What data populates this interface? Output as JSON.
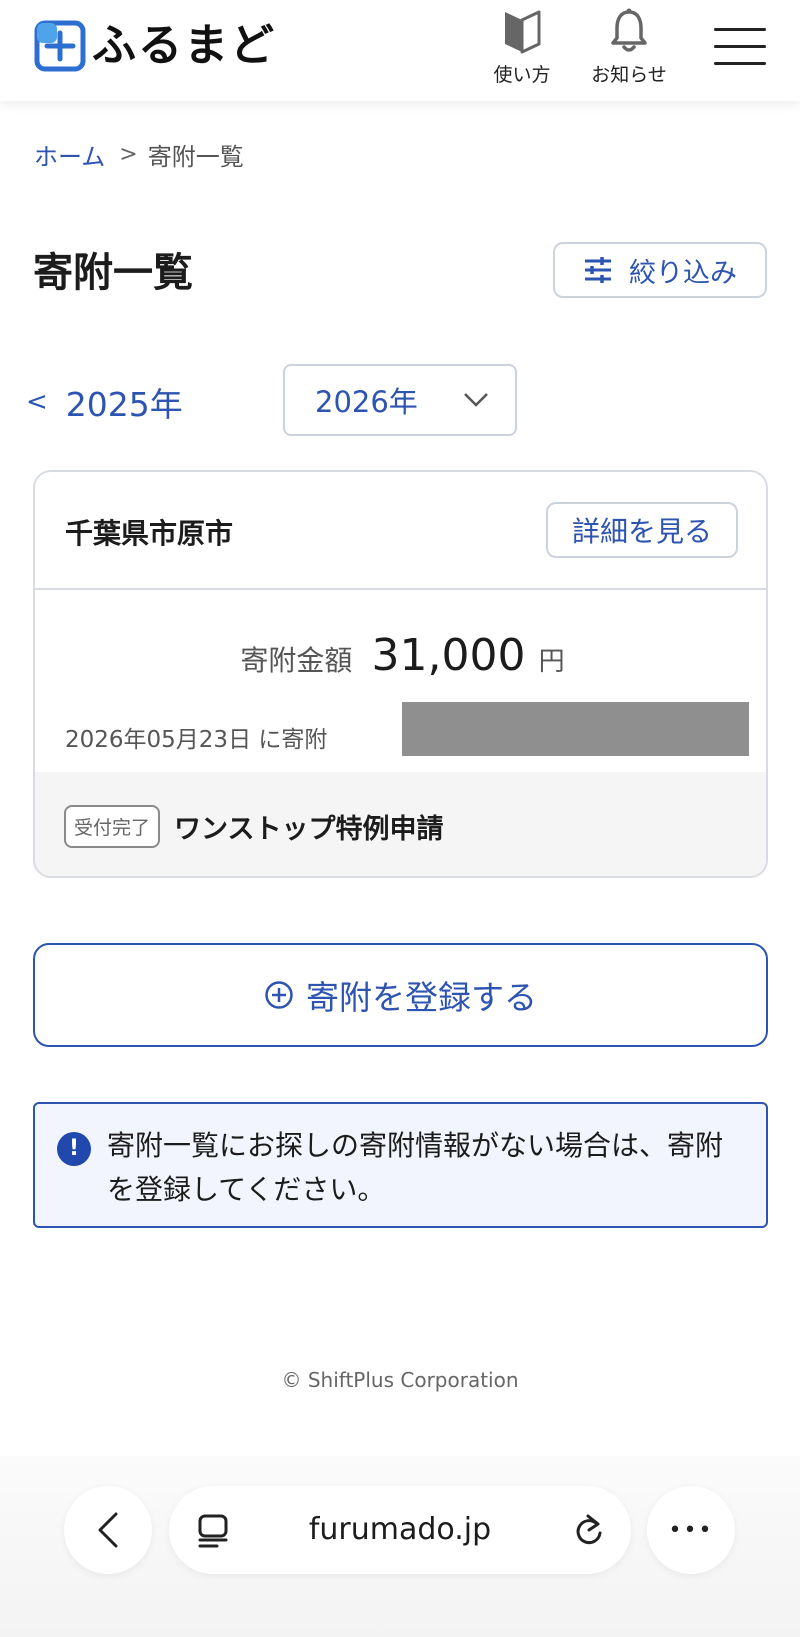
{
  "header": {
    "logo_text": "ふるまど",
    "howto_label": "使い方",
    "notice_label": "お知らせ"
  },
  "breadcrumb": {
    "home": "ホーム",
    "separator": ">",
    "current": "寄附一覧"
  },
  "page": {
    "title": "寄附一覧",
    "filter_label": "絞り込み"
  },
  "year_nav": {
    "prev_chevron": "<",
    "prev_year": "2025年",
    "selected_year": "2026年"
  },
  "donations": [
    {
      "municipality": "千葉県市原市",
      "detail_label": "詳細を見る",
      "amount_label": "寄附金額",
      "amount_value": "31,000",
      "amount_unit": "円",
      "date_text": "2026年05月23日 に寄附",
      "status_badge": "受付完了",
      "status_text": "ワンストップ特例申請"
    }
  ],
  "register_button_label": "寄附を登録する",
  "info_message": "寄附一覧にお探しの寄附情報がない場合は、寄附を登録してください。",
  "info_icon_glyph": "!",
  "footer": {
    "copyright": "© ShiftPlus Corporation"
  },
  "browser": {
    "url": "furumado.jp",
    "more_glyph": "•••"
  },
  "colors": {
    "accent": "#2d54b0",
    "info_bg": "#f2f5fd",
    "border": "#d8dce2",
    "redacted": "#8f8f8f"
  }
}
